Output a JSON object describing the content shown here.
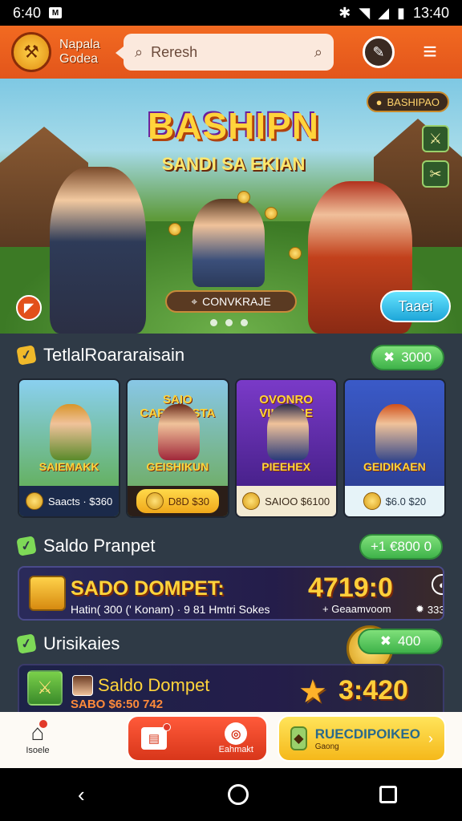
{
  "status_bar": {
    "time_left": "6:40",
    "badge": "M",
    "time_right": "13:40",
    "icons": [
      "bluetooth-icon",
      "wifi-icon",
      "signal-icon",
      "battery-icon"
    ]
  },
  "header": {
    "brand_line1": "Napala",
    "brand_line2": "Godea",
    "search_placeholder": "Reresh",
    "icons": [
      "logo-icon",
      "search-icon",
      "chat-icon",
      "menu-icon"
    ]
  },
  "hero": {
    "title": "BASHIPN",
    "subtitle": "SANDI SA EKIAN",
    "top_pill": "BASHIPAO",
    "location": "CONVKRAJE",
    "cta": "Taaei",
    "page_dots": 3
  },
  "section1": {
    "title": "TetlalRoararaisain",
    "pill": "3000",
    "cards": [
      {
        "top_title": "",
        "title": "SAIEMAKK",
        "footer": "Saacts · $360"
      },
      {
        "top_title": "SAIO CARBOESTA",
        "title": "GEISHIKUN",
        "footer": "D8D $30"
      },
      {
        "top_title": "OVONRO VIHOSSE",
        "title": "PIEEHEX",
        "footer": "SAIOO $6100"
      },
      {
        "top_title": "",
        "title": "GEIDIKAEN",
        "footer": "$6.0 $20"
      }
    ]
  },
  "section2": {
    "title": "Saldo Pranpet",
    "pill": "+1 €800 0",
    "balance": {
      "title": "SADO DOMPET:",
      "amount": "4719:0",
      "subtitle": "Hatin( 300 (' Konam) · 9 81 Hmtri Sokes",
      "right_text": "+ Geaamvoom",
      "coins": "333"
    }
  },
  "section3": {
    "title": "Urisikaies",
    "pill": "400",
    "balance": {
      "title": "Saldo Dompet",
      "subtitle": "SABO $6:50 742",
      "amount": "3:420"
    }
  },
  "bottom_nav": {
    "home_label": "Isoele",
    "center_label": "Eahmakt",
    "cta_title": "RUECDIPOIKEO",
    "cta_label": "Gaong"
  },
  "colors": {
    "accent": "#f26a21",
    "gold": "#ffd43b",
    "green": "#3fb34a",
    "bg": "#2f3a46"
  }
}
